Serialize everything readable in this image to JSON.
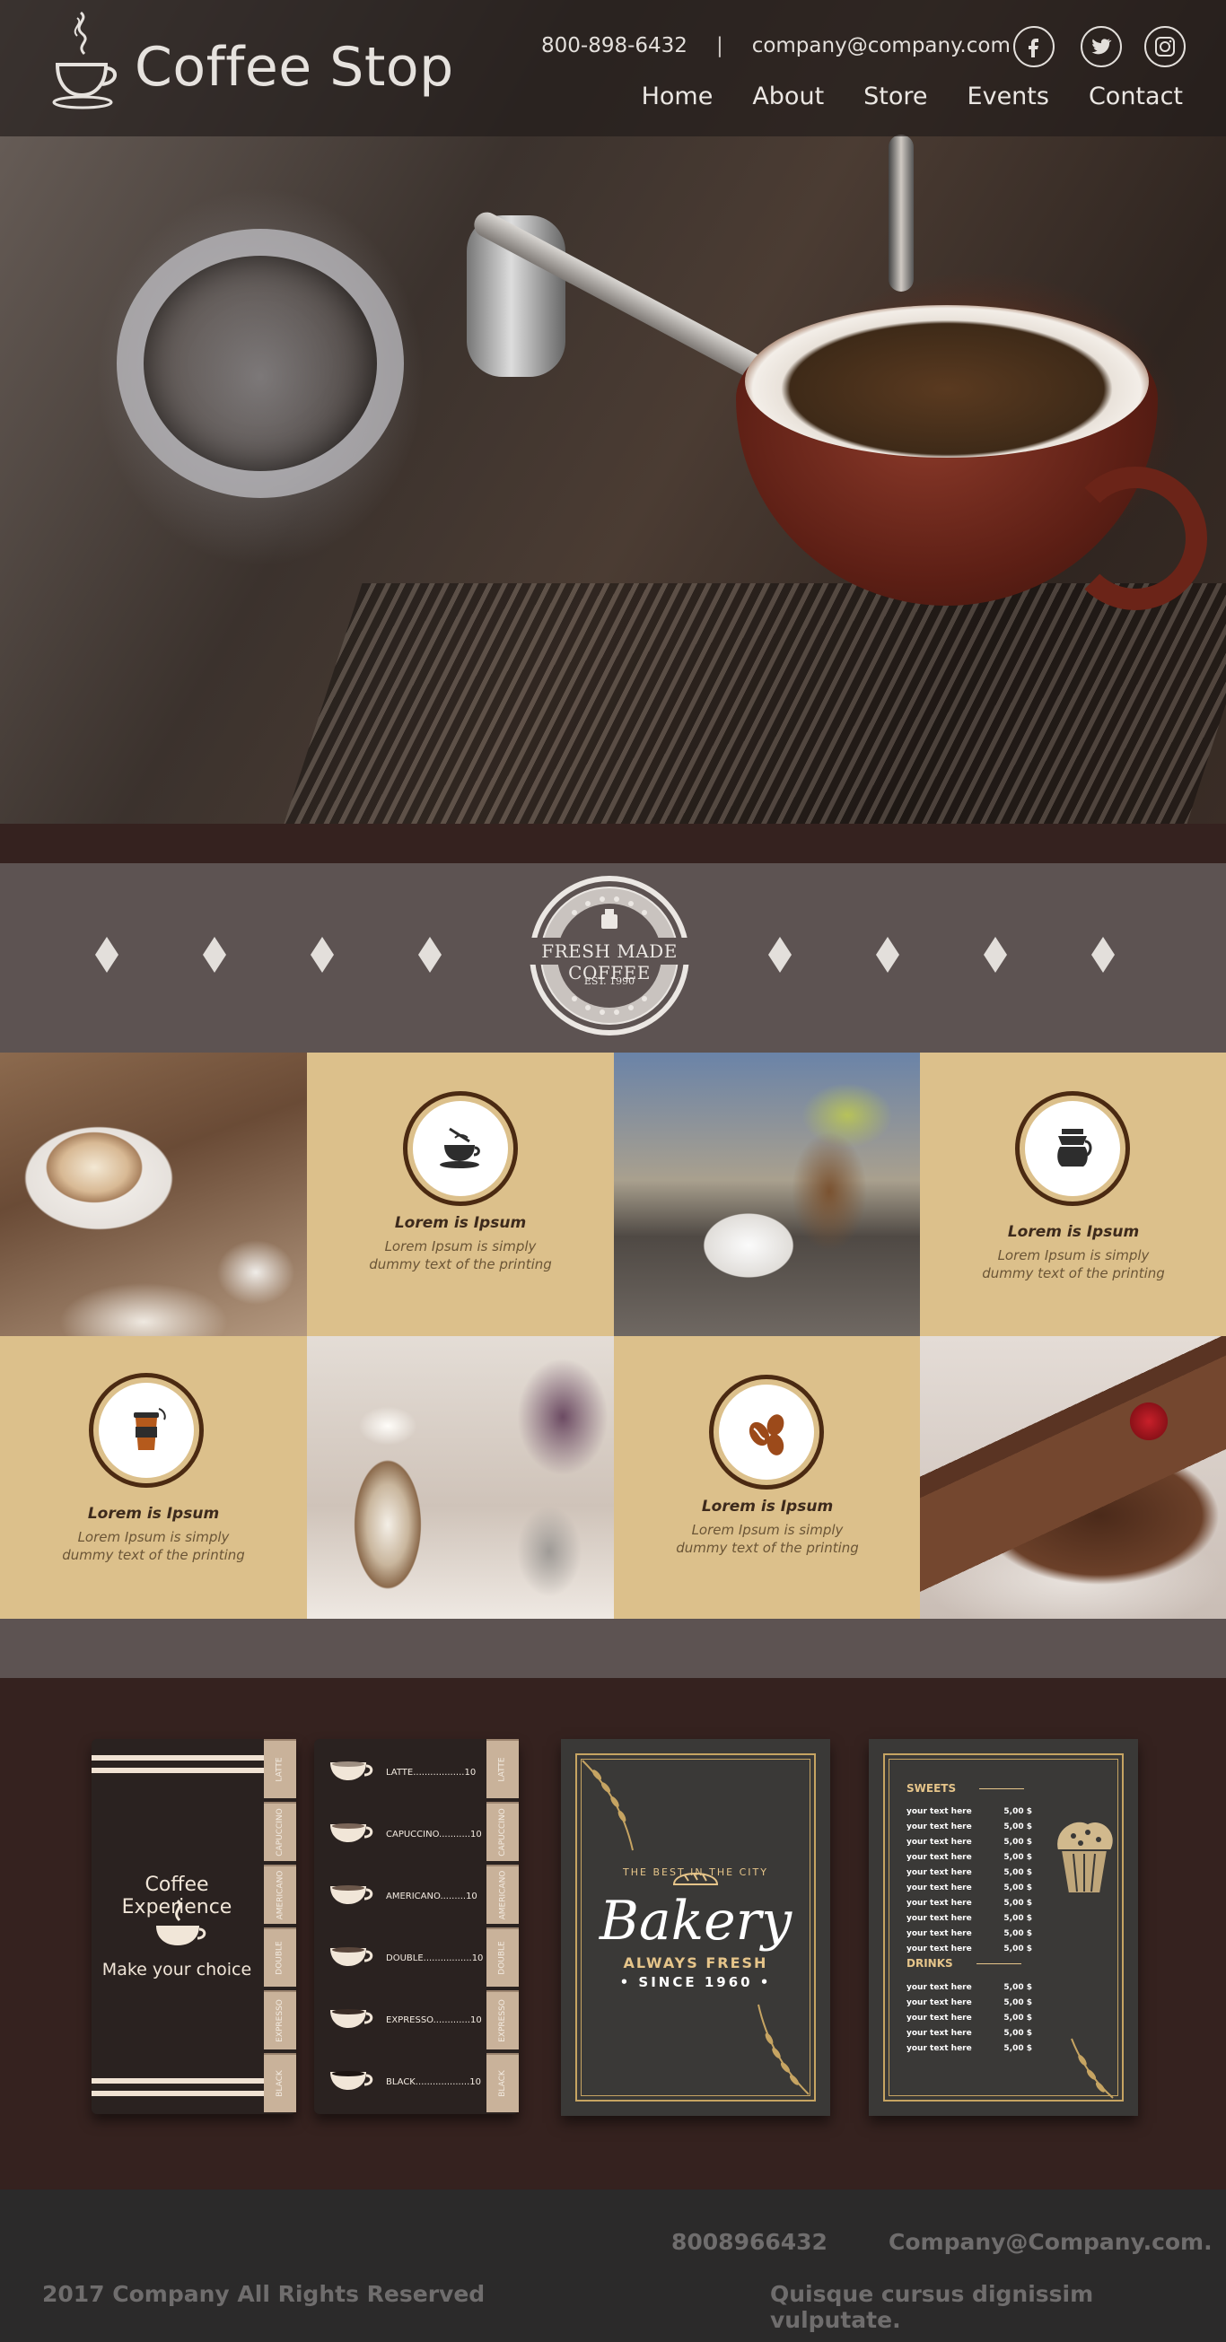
{
  "brand": {
    "name": "Coffee Stop"
  },
  "header": {
    "phone": "800-898-6432",
    "separator": "|",
    "email": "company@company.com",
    "social": [
      "facebook-icon",
      "twitter-icon",
      "instagram-icon"
    ]
  },
  "nav": {
    "items": [
      "Home",
      "About",
      "Store",
      "Events",
      "Contact"
    ]
  },
  "badge": {
    "title": "FRESH MADE COFFEE",
    "est": "EST. 1990"
  },
  "features": [
    {
      "icon": "coffee-cup-icon",
      "title": "Lorem is Ipsum",
      "text": "Lorem Ipsum is simply dummy text of the printing"
    },
    {
      "icon": "coffee-pot-icon",
      "title": "Lorem is Ipsum",
      "text": "Lorem Ipsum is simply dummy text of the printing"
    },
    {
      "icon": "takeaway-cup-icon",
      "title": "Lorem is Ipsum",
      "text": "Lorem Ipsum is simply dummy text of the printing"
    },
    {
      "icon": "coffee-beans-icon",
      "title": "Lorem is Ipsum",
      "text": "Lorem Ipsum is simply dummy text of the printing"
    }
  ],
  "menu_cover": {
    "line1": "Coffee Experience",
    "line2": "Make your choice"
  },
  "menu_tabs": [
    "LATTE",
    "CAPUCCINO",
    "AMERICANO",
    "DOUBLE",
    "EXPRESSO",
    "BLACK"
  ],
  "menu_items": [
    {
      "name": "LATTE..................",
      "price": "10"
    },
    {
      "name": "CAPUCCINO...........",
      "price": "10"
    },
    {
      "name": "AMERICANO.........",
      "price": "10"
    },
    {
      "name": "DOUBLE.................",
      "price": "10"
    },
    {
      "name": "EXPRESSO.............",
      "price": "10"
    },
    {
      "name": "BLACK...................",
      "price": "10"
    }
  ],
  "bakery": {
    "tagline": "THE BEST IN THE CITY",
    "title": "Bakery",
    "subtitle": "ALWAYS FRESH",
    "since": "• SINCE 1960 •"
  },
  "price_list": {
    "sweets_title": "SWEETS",
    "drinks_title": "DRINKS",
    "sweets": [
      {
        "item": "your text here",
        "price": "5,00 $"
      },
      {
        "item": "your text here",
        "price": "5,00 $"
      },
      {
        "item": "your text here",
        "price": "5,00 $"
      },
      {
        "item": "your text here",
        "price": "5,00 $"
      },
      {
        "item": "your text here",
        "price": "5,00 $"
      },
      {
        "item": "your text here",
        "price": "5,00 $"
      },
      {
        "item": "your text here",
        "price": "5,00 $"
      },
      {
        "item": "your text here",
        "price": "5,00 $"
      },
      {
        "item": "your text here",
        "price": "5,00 $"
      },
      {
        "item": "your text here",
        "price": "5,00 $"
      }
    ],
    "drinks": [
      {
        "item": "your text here",
        "price": "5,00 $"
      },
      {
        "item": "your text here",
        "price": "5,00 $"
      },
      {
        "item": "your text here",
        "price": "5,00 $"
      },
      {
        "item": "your text here",
        "price": "5,00 $"
      },
      {
        "item": "your text here",
        "price": "5,00 $"
      }
    ]
  },
  "footer": {
    "phone": "8008966432",
    "email": "Company@Company.com.",
    "copyright": "2017 Company All Rights Reserved",
    "tagline": "Quisque cursus dignissim vulputate."
  },
  "colors": {
    "header_bg": "#221c1a",
    "accent_tan": "#dcc08b",
    "section_gray": "#5d5352",
    "dark_brown": "#35221f",
    "footer_bg": "#2b2a2a"
  }
}
